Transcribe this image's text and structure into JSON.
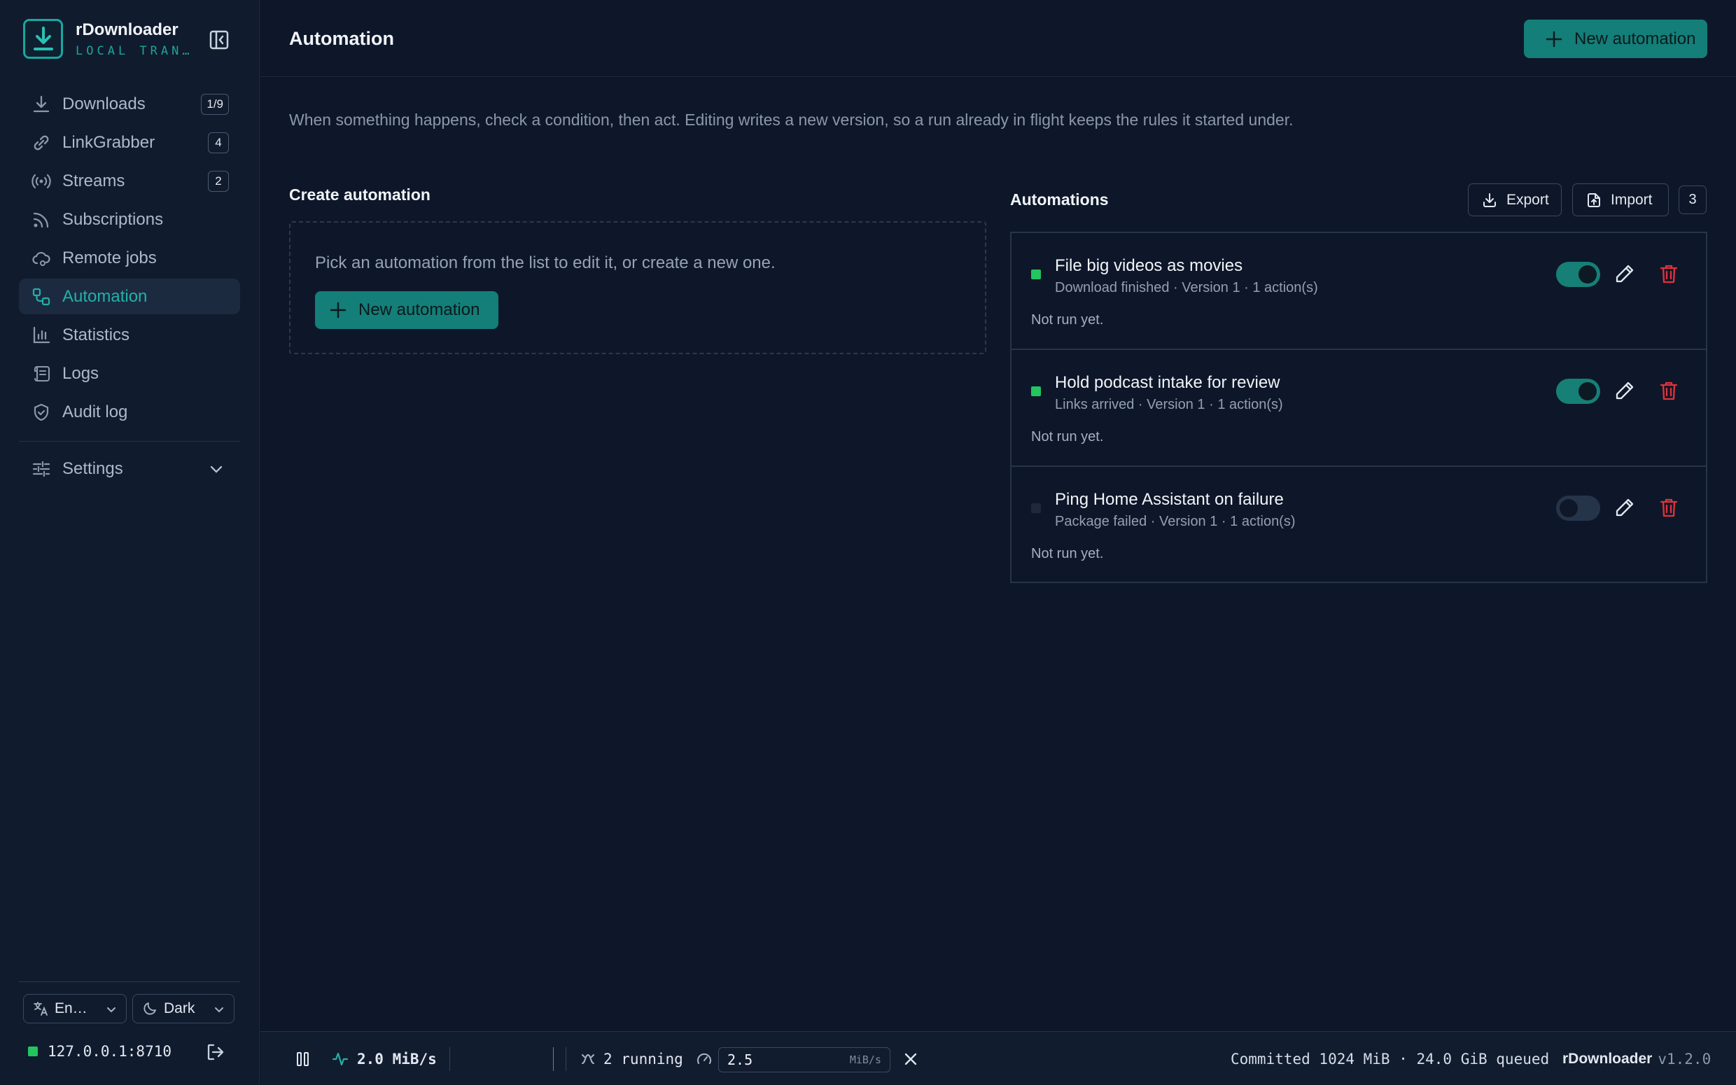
{
  "app": {
    "name": "rDownloader",
    "subtitle": "LOCAL TRAN…",
    "version": "v1.2.0",
    "accent_color": "#19a7a0"
  },
  "sidebar": {
    "items": [
      {
        "label": "Downloads",
        "icon": "download-icon",
        "badge": "1/9"
      },
      {
        "label": "LinkGrabber",
        "icon": "link-icon",
        "badge": "4"
      },
      {
        "label": "Streams",
        "icon": "broadcast-icon",
        "badge": "2"
      },
      {
        "label": "Subscriptions",
        "icon": "rss-icon"
      },
      {
        "label": "Remote jobs",
        "icon": "cloud-icon"
      },
      {
        "label": "Automation",
        "icon": "workflow-icon",
        "active": true
      },
      {
        "label": "Statistics",
        "icon": "bar-chart-icon"
      },
      {
        "label": "Logs",
        "icon": "scroll-icon"
      },
      {
        "label": "Audit log",
        "icon": "shield-icon"
      }
    ],
    "settings_label": "Settings",
    "language": "En…",
    "theme": "Dark",
    "host": "127.0.0.1:8710"
  },
  "header": {
    "title": "Automation",
    "new_button": "New automation"
  },
  "description": "When something happens, check a condition, then act. Editing writes a new version, so a run already in flight keeps the rules it started under.",
  "create": {
    "title": "Create automation",
    "hint": "Pick an automation from the list to edit it, or create a new one.",
    "new_button": "New automation"
  },
  "automations": {
    "title": "Automations",
    "export_label": "Export",
    "import_label": "Import",
    "count": "3",
    "items": [
      {
        "name": "File big videos as movies",
        "meta": "Download finished · Version 1 · 1 action(s)",
        "run_status": "Not run yet.",
        "enabled": true
      },
      {
        "name": "Hold podcast intake for review",
        "meta": "Links arrived · Version 1 · 1 action(s)",
        "run_status": "Not run yet.",
        "enabled": true
      },
      {
        "name": "Ping Home Assistant on failure",
        "meta": "Package failed · Version 1 · 1 action(s)",
        "run_status": "Not run yet.",
        "enabled": false
      }
    ]
  },
  "statusbar": {
    "speed": "2.0 MiB/s",
    "running": "2 running",
    "limit_value": "2.5",
    "limit_unit": "MiB/s",
    "storage": "Committed 1024 MiB · 24.0 GiB queued",
    "app_name": "rDownloader",
    "version": "v1.2.0"
  }
}
